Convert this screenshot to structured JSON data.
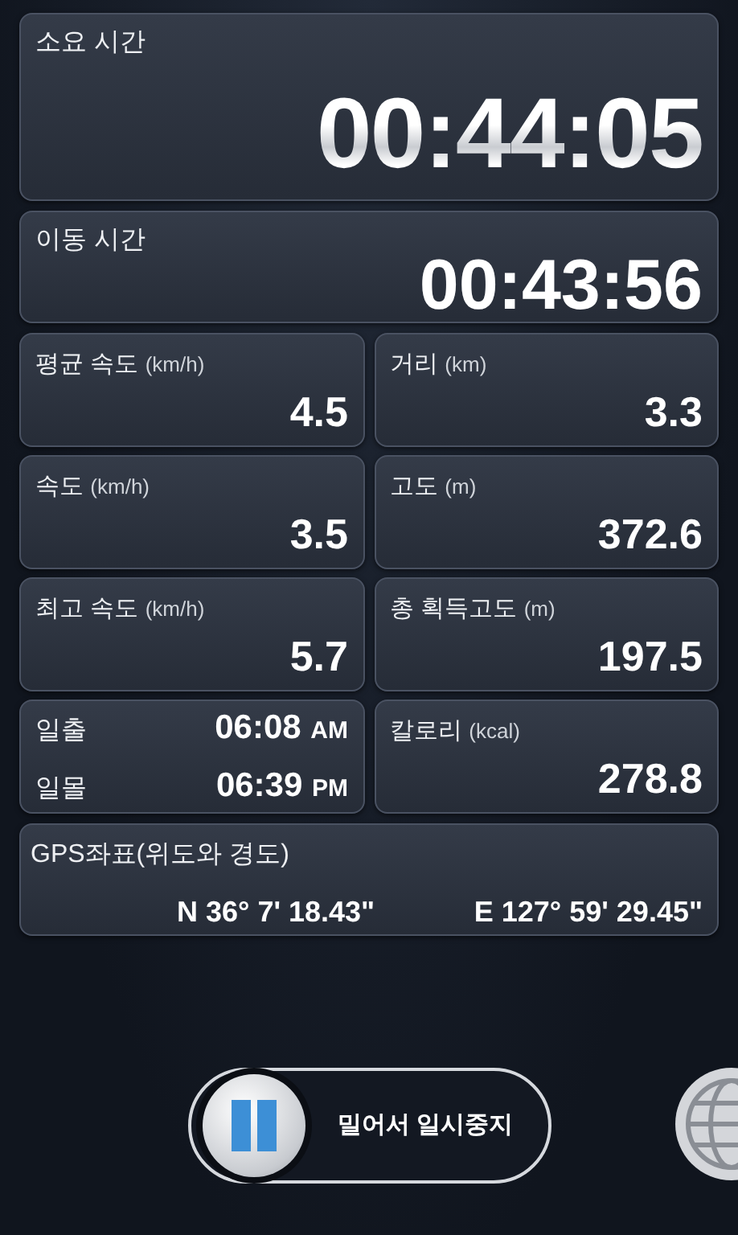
{
  "elapsed": {
    "label": "소요 시간",
    "value": "00:44:05"
  },
  "moving": {
    "label": "이동 시간",
    "value": "00:43:56"
  },
  "stats": [
    {
      "kind": "metric",
      "label": "평균 속도",
      "unit": "(km/h)",
      "value": "4.5"
    },
    {
      "kind": "metric",
      "label": "거리",
      "unit": "(km)",
      "value": "3.3"
    },
    {
      "kind": "metric",
      "label": "속도",
      "unit": "(km/h)",
      "value": "3.5"
    },
    {
      "kind": "metric",
      "label": "고도",
      "unit": "(m)",
      "value": "372.6"
    },
    {
      "kind": "metric",
      "label": "최고 속도",
      "unit": "(km/h)",
      "value": "5.7"
    },
    {
      "kind": "metric",
      "label": "총 획득고도",
      "unit": "(m)",
      "value": "197.5"
    },
    {
      "kind": "sun",
      "rows": [
        {
          "label": "일출",
          "time": "06:08",
          "suffix": "AM"
        },
        {
          "label": "일몰",
          "time": "06:39",
          "suffix": "PM"
        }
      ]
    },
    {
      "kind": "metric",
      "label": "칼로리",
      "unit": "(kcal)",
      "value": "278.8"
    }
  ],
  "gps": {
    "label": "GPS좌표(위도와 경도)",
    "latitude": "N 36° 7' 18.43\"",
    "longitude": "E 127° 59' 29.45\""
  },
  "slider": {
    "label": "밀어서 일시중지"
  }
}
